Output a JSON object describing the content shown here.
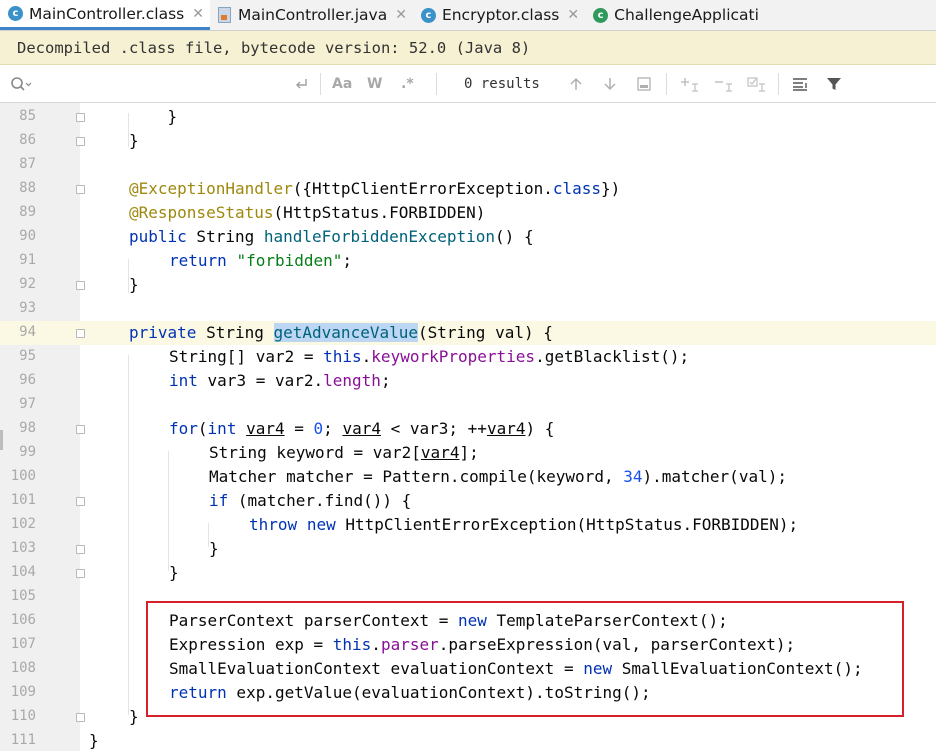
{
  "tabs": [
    {
      "label": "MainController.class",
      "icon": "class-icon",
      "active": true
    },
    {
      "label": "MainController.java",
      "icon": "java-file-icon",
      "active": false
    },
    {
      "label": "Encryptor.class",
      "icon": "class-icon",
      "active": false
    },
    {
      "label": "ChallengeApplicati",
      "icon": "spring-boot-class-icon",
      "active": false
    }
  ],
  "banner": "Decompiled .class file, bytecode version: 52.0 (Java 8)",
  "search": {
    "results": "0 results",
    "match_case": "Aa",
    "words": "W",
    "regex": ".*"
  },
  "lines": [
    {
      "n": "85"
    },
    {
      "n": "86"
    },
    {
      "n": "87"
    },
    {
      "n": "88"
    },
    {
      "n": "89"
    },
    {
      "n": "90"
    },
    {
      "n": "91"
    },
    {
      "n": "92"
    },
    {
      "n": "93"
    },
    {
      "n": "94"
    },
    {
      "n": "95"
    },
    {
      "n": "96"
    },
    {
      "n": "97"
    },
    {
      "n": "98"
    },
    {
      "n": "99"
    },
    {
      "n": "100"
    },
    {
      "n": "101"
    },
    {
      "n": "102"
    },
    {
      "n": "103"
    },
    {
      "n": "104"
    },
    {
      "n": "105"
    },
    {
      "n": "106"
    },
    {
      "n": "107"
    },
    {
      "n": "108"
    },
    {
      "n": "109"
    },
    {
      "n": "110"
    },
    {
      "n": "111"
    }
  ],
  "code": {
    "l85": "    }",
    "l86": "}",
    "l88_ann1": "@ExceptionHandler",
    "l88_rest1": "({HttpClientErrorException.",
    "l88_kw": "class",
    "l88_rest2": "})",
    "l89_ann": "@ResponseStatus",
    "l89_rest": "(HttpStatus.FORBIDDEN)",
    "l90_kw": "public",
    "l90_type": " String ",
    "l90_method": "handleForbiddenException",
    "l90_rest": "() {",
    "l91_kw": "return",
    "l91_str": "\"forbidden\"",
    "l91_rest": ";",
    "l92": "}",
    "l94_kw": "private",
    "l94_type": " String ",
    "l94_method": "getAdvanceValue",
    "l94_rest": "(String val) {",
    "l95_a": "String[] var2 = ",
    "l95_this": "this",
    "l95_dot": ".",
    "l95_field": "keyworkProperties",
    "l95_rest": ".getBlacklist();",
    "l96_kw": "int",
    "l96_a": " var3 = var2.",
    "l96_field": "length",
    "l96_rest": ";",
    "l98_kw1": "for",
    "l98_p1": "(",
    "l98_kw2": "int",
    "l98_sp": " ",
    "l98_v1": "var4",
    "l98_eq": " = ",
    "l98_n0": "0",
    "l98_semi": "; ",
    "l98_v2": "var4",
    "l98_lt": " < var3; ++",
    "l98_v3": "var4",
    "l98_end": ") {",
    "l99_a": "String keyword = var2[",
    "l99_v": "var4",
    "l99_b": "];",
    "l100_a": "Matcher matcher = Pattern.compile(keyword, ",
    "l100_n": "34",
    "l100_b": ").matcher(val);",
    "l101_kw": "if",
    "l101_rest": " (matcher.find()) {",
    "l102_kw1": "throw",
    "l102_kw2": "new",
    "l102_rest": " HttpClientErrorException(HttpStatus.FORBIDDEN);",
    "l103": "}",
    "l104": "}",
    "l106_a": "ParserContext parserContext = ",
    "l106_kw": "new",
    "l106_b": " TemplateParserContext();",
    "l107_a": "Expression exp = ",
    "l107_this": "this",
    "l107_dot": ".",
    "l107_field": "parser",
    "l107_b": ".parseExpression(val, parserContext);",
    "l108_a": "SmallEvaluationContext evaluationContext = ",
    "l108_kw": "new",
    "l108_b": " SmallEvaluationContext();",
    "l109_kw": "return",
    "l109_b": " exp.getValue(evaluationContext).toString();",
    "l110": "}",
    "l111": "}"
  }
}
